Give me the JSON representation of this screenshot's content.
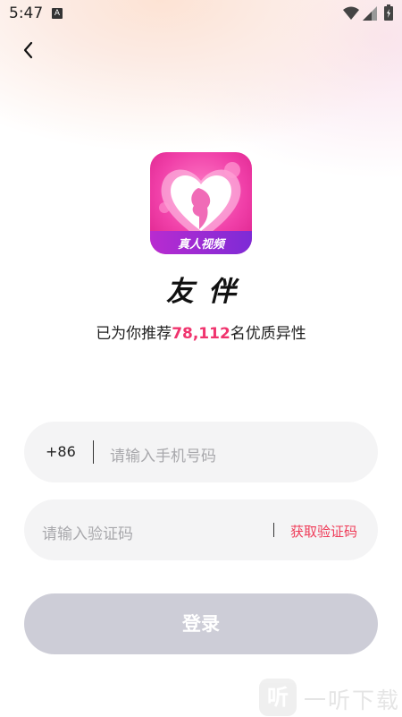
{
  "status_bar": {
    "time": "5:47",
    "notification_badge": "A"
  },
  "icons": [
    "back-icon",
    "wifi-icon",
    "signal-icon",
    "battery-icon",
    "heart-logo-icon"
  ],
  "app": {
    "logo_ribbon_text": "真人视频",
    "name": "友伴"
  },
  "recommend": {
    "prefix": "已为你推荐",
    "count": "78,112",
    "suffix": "名优质异性"
  },
  "phone_field": {
    "country_code": "+86",
    "placeholder": "请输入手机号码"
  },
  "code_field": {
    "placeholder": "请输入验证码",
    "get_code_label": "获取验证码"
  },
  "login": {
    "label": "登录"
  },
  "watermark": {
    "logo_char": "听",
    "text": "一听下载"
  },
  "colors": {
    "accent": "#f0346e",
    "get_code": "#ef3b58",
    "button_disabled": "#cdcdd7",
    "field_bg": "#f4f4f5",
    "logo_pink": "#f03fa8"
  }
}
